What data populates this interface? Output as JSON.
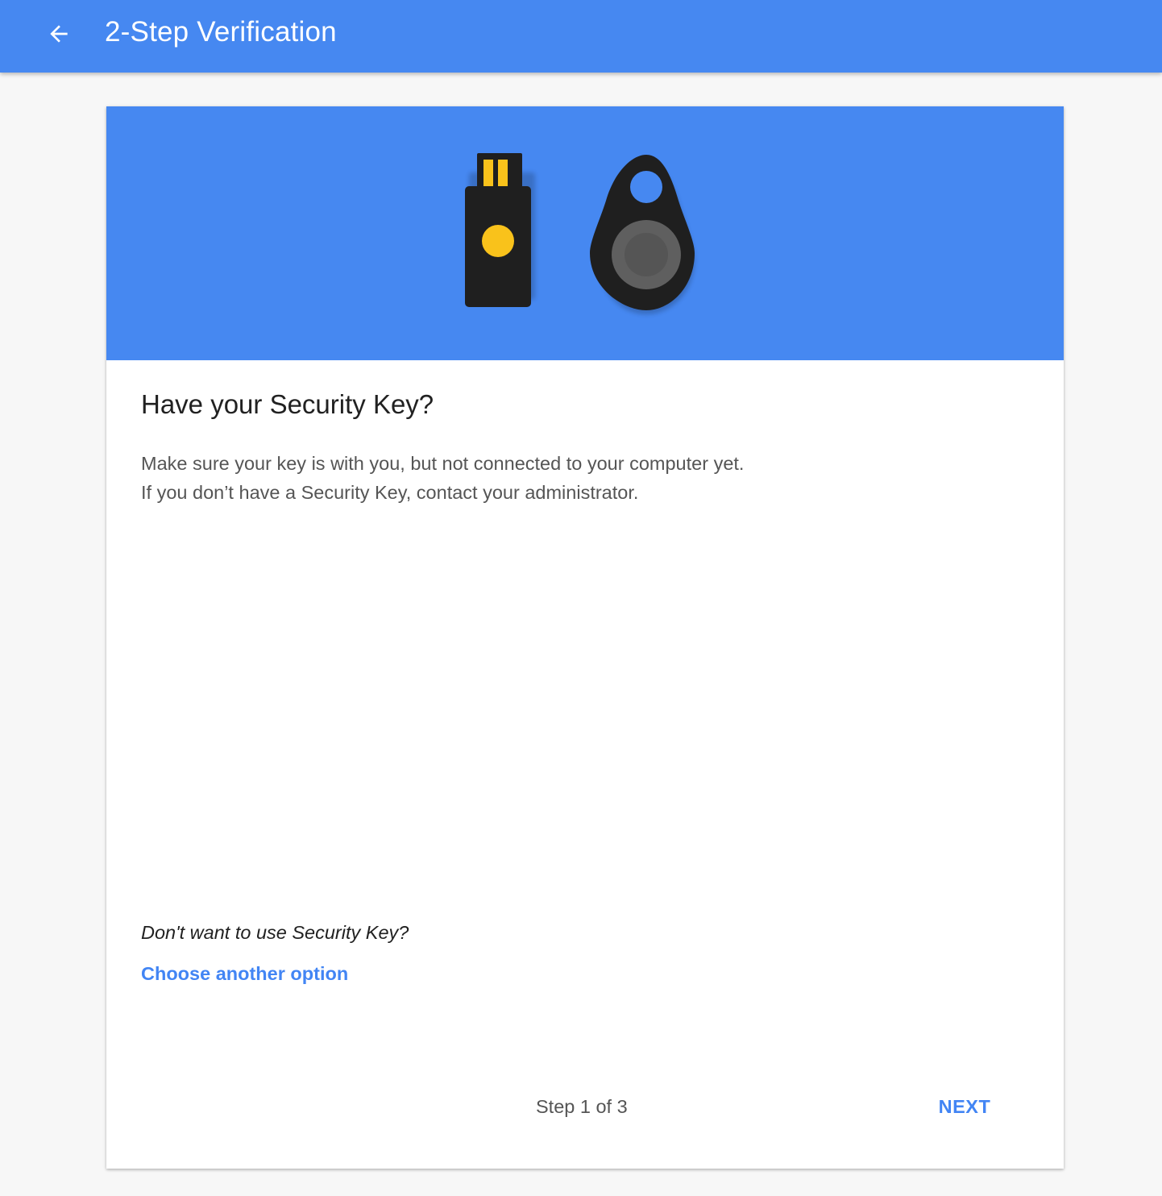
{
  "app_bar": {
    "title": "2-Step Verification",
    "back_icon": "arrow-back-icon",
    "color": "#4688f1"
  },
  "card": {
    "hero_illustration": {
      "icons": [
        "usb-security-key-icon",
        "fob-security-key-icon"
      ],
      "background": "#4688f1"
    },
    "heading": "Have your Security Key?",
    "description_lines": [
      "Make sure your key is with you, but not connected to your computer yet.",
      "If you don’t have a Security Key, contact your administrator."
    ],
    "alternative": {
      "question": "Don't want to use Security Key?",
      "link_label": "Choose another option"
    },
    "footer": {
      "step_indicator": "Step 1 of 3",
      "next_label": "NEXT"
    }
  },
  "colors": {
    "accent": "#4285f4",
    "key_gold": "#f9c21b"
  }
}
